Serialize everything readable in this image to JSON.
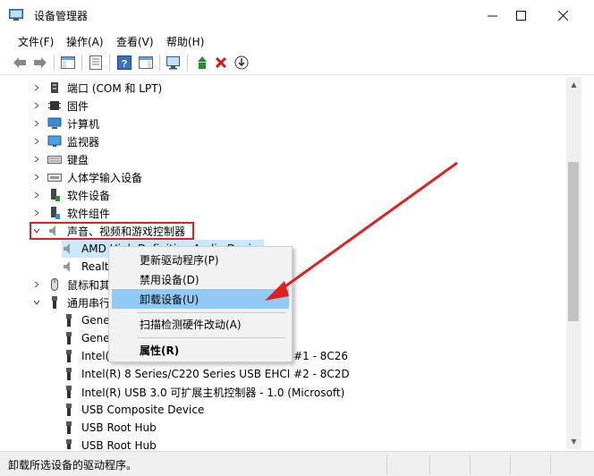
{
  "window": {
    "title": "设备管理器",
    "minimize": "—",
    "maximize": "☐",
    "close": "✕"
  },
  "menu": {
    "file": "文件(F)",
    "action": "操作(A)",
    "view": "查看(V)",
    "help": "帮助(H)"
  },
  "tree": {
    "ports": "端口 (COM 和 LPT)",
    "firmware": "固件",
    "computer": "计算机",
    "monitors": "监视器",
    "keyboards": "键盘",
    "hid": "人体学输入设备",
    "software_devices": "软件设备",
    "software_components": "软件组件",
    "sound": "声音、视频和游戏控制器",
    "amd_audio": "AMD High Definition Audio Device",
    "realtek_audio": "Realtek High Definition Audio",
    "mice": "鼠标和其他指针设备",
    "usb_controllers": "通用串行总线控制器",
    "generic_hub1": "Generic USB Hub",
    "generic_hub2": "Generic USB Hub",
    "ehci1": "Intel(R) 8 Series/C220 Series USB EHCI #1 - 8C26",
    "ehci2": "Intel(R) 8 Series/C220 Series USB EHCI #2 - 8C2D",
    "usb3": "Intel(R) USB 3.0 可扩展主机控制器 - 1.0 (Microsoft)",
    "composite": "USB Composite Device",
    "root_hub1": "USB Root Hub",
    "root_hub2": "USB Root Hub"
  },
  "context_menu": {
    "update_driver": "更新驱动程序(P)",
    "disable_device": "禁用设备(D)",
    "uninstall_device": "卸载设备(U)",
    "scan_hardware": "扫描检测硬件改动(A)",
    "properties": "属性(R)"
  },
  "status": {
    "text": "卸载所选设备的驱动程序。"
  },
  "colors": {
    "highlight_border": "#e02020",
    "arrow": "#e02020",
    "selection": "#cce8ff",
    "menu_active": "#91c9f7"
  }
}
